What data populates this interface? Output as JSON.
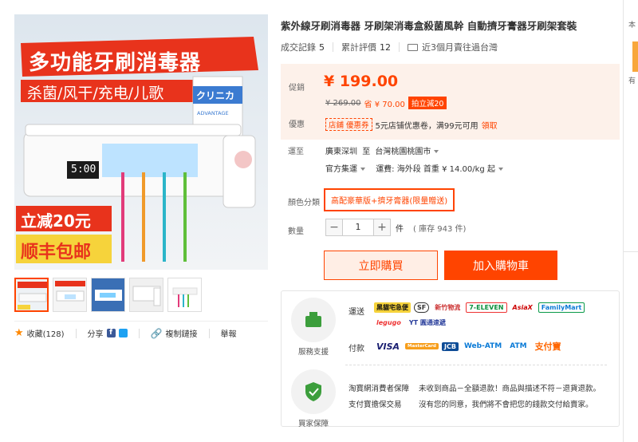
{
  "product": {
    "title": "紫外線牙刷消毒器 牙刷架消毒盒殺菌風幹 自動擠牙膏器牙刷架套裝",
    "stats": {
      "sales_label": "成交記錄",
      "sales_value": "5",
      "reviews_label": "累計評價",
      "reviews_value": "12",
      "ship_note": "近3個月賣往過台灣"
    },
    "image": {
      "headline": "多功能牙刷消毒器",
      "subline": "杀菌/风干/充电/儿歌",
      "display_time": "5:00",
      "toothpaste_brand": "クリニカ",
      "toothpaste_sub": "ADVANTAGE",
      "promo1": "立减20元",
      "promo2": "顺丰包邮"
    },
    "thumbs_count": 5
  },
  "actions": {
    "favorite": "收藏(128)",
    "share": "分享",
    "copy_link": "複制鏈接",
    "report": "舉報"
  },
  "price": {
    "label": "促銷",
    "current": "¥ 199.00",
    "original": "¥ 269.00",
    "save": "省 ¥ 70.00",
    "badge": "拍立減20",
    "coupon_label": "優惠",
    "coupon_tag": "店鋪 優惠券",
    "coupon_text": "5元店铺优惠卷，满99元可用",
    "coupon_link": "領取"
  },
  "shipping": {
    "label": "運至",
    "from": "廣東深圳",
    "to_word": "至",
    "to": "台灣桃園桃園市",
    "method": "官方集運",
    "fee": "運費: 海外段 首重 ¥ 14.00/kg 起"
  },
  "options": {
    "color_label": "顏色分類",
    "color_value": "高配豪華版+擠牙膏器(限量贈送)",
    "qty_label": "數量",
    "qty_value": "1",
    "qty_unit": "件",
    "stock": "( 庫存 943 件)"
  },
  "buttons": {
    "buy_now": "立即購買",
    "add_cart": "加入購物車"
  },
  "service": {
    "support_caption": "服務支援",
    "protect_caption": "買家保障",
    "ship_label": "運送",
    "pay_label": "付款",
    "carriers": [
      "黑貓宅急便",
      "SF",
      "新竹物流",
      "7-ELEVEN",
      "AsiaX",
      "FamilyMart",
      "legugo",
      "YT 圓通速遞"
    ],
    "payments": [
      "VISA",
      "MasterCard",
      "JCB",
      "Web-ATM",
      "ATM",
      "支付寶"
    ],
    "guarantee1_title": "淘寶網消費者保障",
    "guarantee1_text": "未收到商品－全額退款！商品與描述不符－退貨退款。",
    "guarantee2_title": "支付寶擔保交易",
    "guarantee2_text": "沒有您的同意，我們將不會把您的錢款交付給賣家。"
  },
  "edge": {
    "top_text": "本",
    "mid_text": "有"
  },
  "colors": {
    "accent": "#ff4400",
    "price_bg": "#fdf1ea"
  }
}
